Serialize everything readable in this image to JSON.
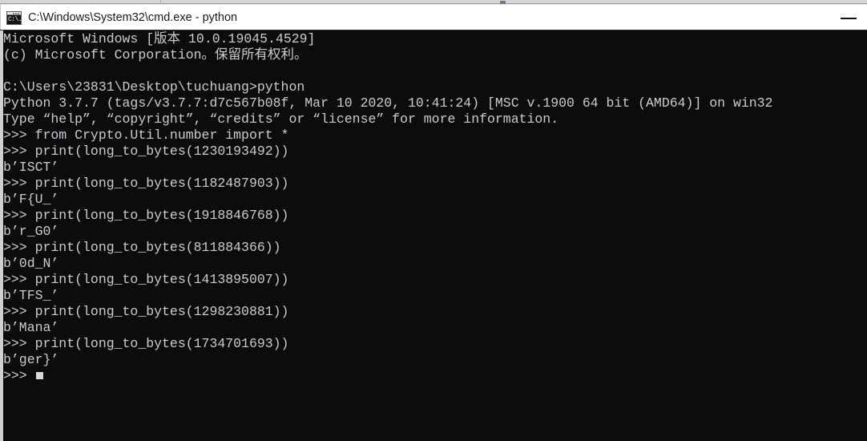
{
  "window": {
    "title": "C:\\Windows\\System32\\cmd.exe - python",
    "icon": "cmd-console-icon",
    "icon_glyph": "C:\\.",
    "controls": {
      "minimize_label": "—"
    },
    "colors": {
      "console_background": "#0c0c0c",
      "console_foreground": "#ccccd0",
      "titlebar_background": "#ffffff",
      "titlebar_foreground": "#1a1a1a",
      "window_border": "#d0d0d0",
      "cursor": "#d8d8d8"
    }
  },
  "console": {
    "lines": [
      "Microsoft Windows [版本 10.0.19045.4529]",
      "(c) Microsoft Corporation。保留所有权利。",
      "",
      "C:\\Users\\23831\\Desktop\\tuchuang>python",
      "Python 3.7.7 (tags/v3.7.7:d7c567b08f, Mar 10 2020, 10:41:24) [MSC v.1900 64 bit (AMD64)] on win32",
      "Type “help”, “copyright”, “credits” or “license” for more information.",
      ">>> from Crypto.Util.number import *",
      ">>> print(long_to_bytes(1230193492))",
      "b’ISCT’",
      ">>> print(long_to_bytes(1182487903))",
      "b’F{U_’",
      ">>> print(long_to_bytes(1918846768))",
      "b’r_G0’",
      ">>> print(long_to_bytes(811884366))",
      "b’0d_N’",
      ">>> print(long_to_bytes(1413895007))",
      "b’TFS_’",
      ">>> print(long_to_bytes(1298230881))",
      "b’Mana’",
      ">>> print(long_to_bytes(1734701693))",
      "b’ger}’",
      ">>> "
    ],
    "prompt": ">>>",
    "shell_prompt": "C:\\Users\\23831\\Desktop\\tuchuang>",
    "command": "python",
    "python_version": "Python 3.7.7",
    "os_version": "10.0.19045.4529",
    "import_statement": "from Crypto.Util.number import *",
    "calls": [
      {
        "argument": "1230193492",
        "output": "b’ISCT’"
      },
      {
        "argument": "1182487903",
        "output": "b’F{U_’"
      },
      {
        "argument": "1918846768",
        "output": "b’r_G0’"
      },
      {
        "argument": "811884366",
        "output": "b’0d_N’"
      },
      {
        "argument": "1413895007",
        "output": "b’TFS_’"
      },
      {
        "argument": "1298230881",
        "output": "b’Mana’"
      },
      {
        "argument": "1734701693",
        "output": "b’ger}’"
      }
    ]
  }
}
